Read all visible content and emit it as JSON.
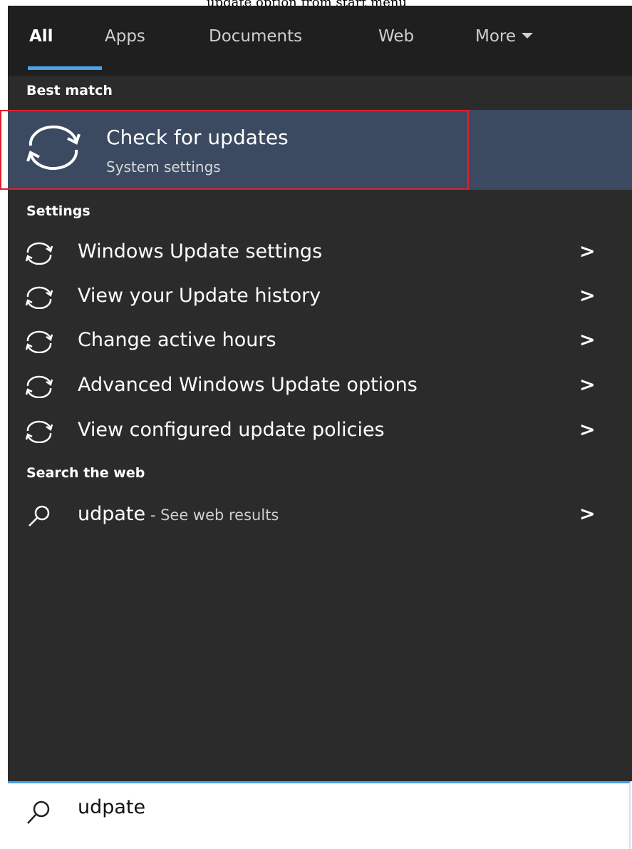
{
  "caption": "update option from start menu",
  "tabs": [
    {
      "label": "All",
      "active": true
    },
    {
      "label": "Apps"
    },
    {
      "label": "Documents"
    },
    {
      "label": "Web"
    },
    {
      "label": "More"
    }
  ],
  "sections": {
    "best_match": "Best match",
    "settings": "Settings",
    "search_web": "Search the web"
  },
  "best_match": {
    "title": "Check for updates",
    "subtitle": "System settings",
    "icon": "sync-icon"
  },
  "settings_items": [
    {
      "label": "Windows Update settings",
      "icon": "sync-icon"
    },
    {
      "label": "View your Update history",
      "icon": "sync-icon"
    },
    {
      "label": "Change active hours",
      "icon": "sync-icon"
    },
    {
      "label": "Advanced Windows Update options",
      "icon": "sync-icon"
    },
    {
      "label": "View configured update policies",
      "icon": "sync-icon"
    }
  ],
  "web_result": {
    "query": "udpate",
    "suffix": " - See web results",
    "icon": "search-icon"
  },
  "chevron": ">",
  "search": {
    "value": "udpate"
  },
  "colors": {
    "panel": "#2b2b2b",
    "tabbar": "#1f1f1f",
    "highlight": "#3b4a61",
    "accent": "#4aa3e8",
    "selection_outline": "#e0202a"
  }
}
